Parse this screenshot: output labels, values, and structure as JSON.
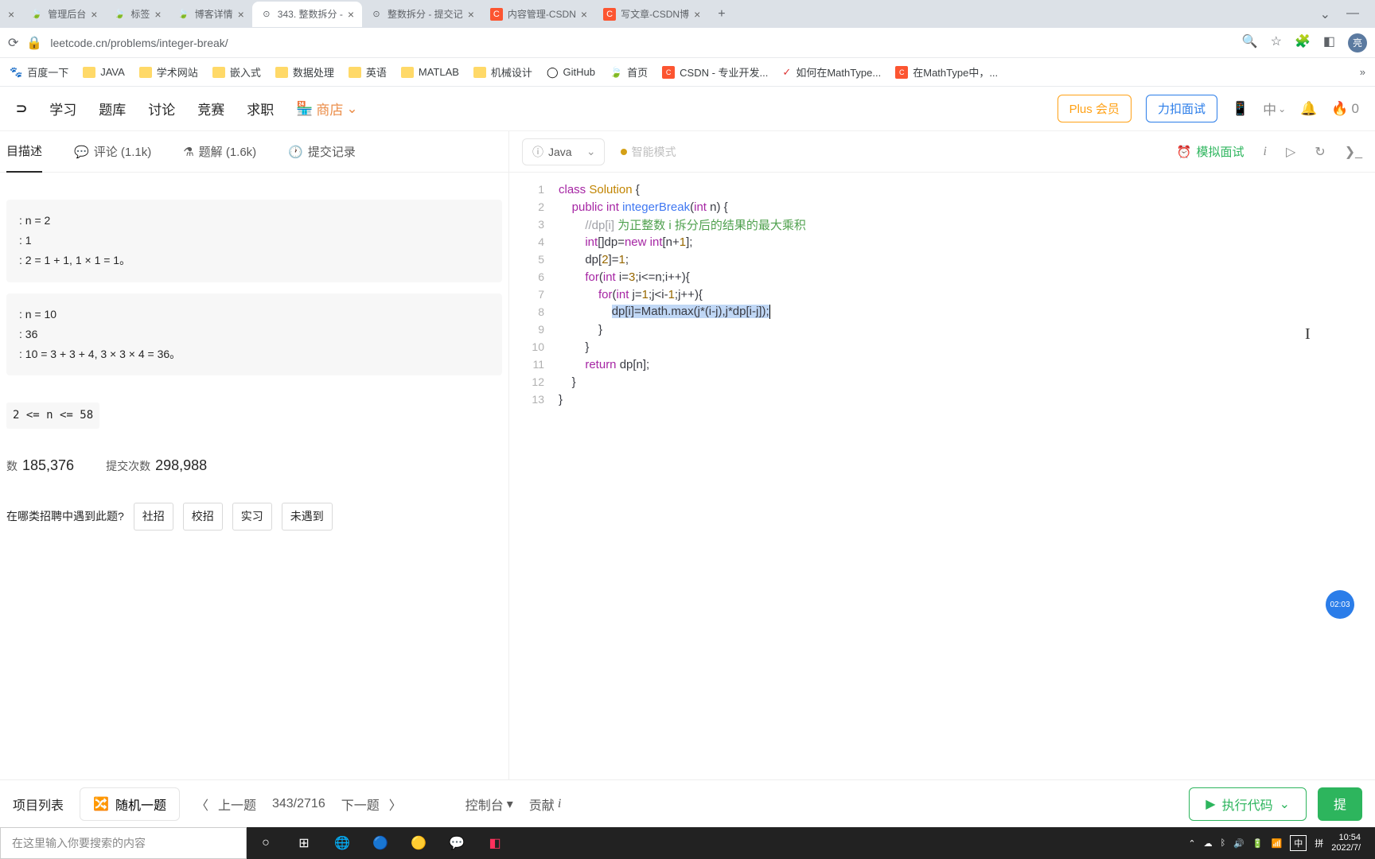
{
  "browser": {
    "tabs": [
      {
        "title": "",
        "icon": ""
      },
      {
        "title": "管理后台",
        "icon": "🍃"
      },
      {
        "title": "标签",
        "icon": "🍃"
      },
      {
        "title": "博客详情",
        "icon": "🍃"
      },
      {
        "title": "343. 整数拆分 - ",
        "icon": "⚙",
        "active": true
      },
      {
        "title": "整数拆分 - 提交记",
        "icon": "⚙"
      },
      {
        "title": "内容管理-CSDN",
        "icon": "C"
      },
      {
        "title": "写文章-CSDN博",
        "icon": "C"
      }
    ],
    "url": "leetcode.cn/problems/integer-break/",
    "bookmarks": [
      {
        "label": "百度一下",
        "type": "baidu"
      },
      {
        "label": "JAVA",
        "type": "folder"
      },
      {
        "label": "学术网站",
        "type": "folder"
      },
      {
        "label": "嵌入式",
        "type": "folder"
      },
      {
        "label": "数据处理",
        "type": "folder"
      },
      {
        "label": "英语",
        "type": "folder"
      },
      {
        "label": "MATLAB",
        "type": "folder"
      },
      {
        "label": "机械设计",
        "type": "folder"
      },
      {
        "label": "GitHub",
        "type": "gh"
      },
      {
        "label": "首页",
        "type": "leaf"
      },
      {
        "label": "CSDN - 专业开发...",
        "type": "csdn"
      },
      {
        "label": "如何在MathType...",
        "type": "check"
      },
      {
        "label": "在MathType中，...",
        "type": "csdn"
      }
    ]
  },
  "nav": {
    "items": [
      "学习",
      "题库",
      "讨论",
      "竞赛",
      "求职"
    ],
    "shop": "商店",
    "plus": "Plus 会员",
    "mock": "力扣面试",
    "fire": "0"
  },
  "problem_tabs": {
    "desc": "目描述",
    "comments": "评论 (1.1k)",
    "solutions": "题解 (1.6k)",
    "history": "提交记录"
  },
  "problem": {
    "ex1": {
      "l1": ": n = 2",
      "l2": ": 1",
      "l3": ": 2 = 1 + 1, 1 × 1 = 1。"
    },
    "ex2": {
      "l1": ": n = 10",
      "l2": ": 36",
      "l3": ": 10 = 3 + 3 + 4, 3 × 3 × 4 = 36。"
    },
    "constraint": "2 <= n <= 58",
    "pass_label": "数",
    "pass_num": "185,376",
    "submit_label": "提交次数",
    "submit_num": "298,988",
    "recruit_q": "在哪类招聘中遇到此题?",
    "recruit_tags": [
      "社招",
      "校招",
      "实习",
      "未遇到"
    ]
  },
  "code": {
    "language": "Java",
    "smart": "智能模式",
    "sim": "模拟面试",
    "lines": [
      {
        "n": 1
      },
      {
        "n": 2
      },
      {
        "n": 3
      },
      {
        "n": 4
      },
      {
        "n": 5
      },
      {
        "n": 6
      },
      {
        "n": 7
      },
      {
        "n": 8
      },
      {
        "n": 9
      },
      {
        "n": 10
      },
      {
        "n": 11
      },
      {
        "n": 12
      },
      {
        "n": 13
      }
    ],
    "comment_cn": "为正整数 i 拆分后的结果的最大乘积"
  },
  "bottom": {
    "list": "项目列表",
    "random": "随机一题",
    "prev": "上一题",
    "counter": "343/2716",
    "next": "下一题",
    "console": "控制台",
    "contrib": "贡献",
    "run": "执行代码",
    "submit": "提"
  },
  "timer": "02:03",
  "taskbar": {
    "search_ph": "在这里输入你要搜索的内容",
    "ime1": "中",
    "ime2": "拼",
    "time": "10:54",
    "date": "2022/7/"
  }
}
